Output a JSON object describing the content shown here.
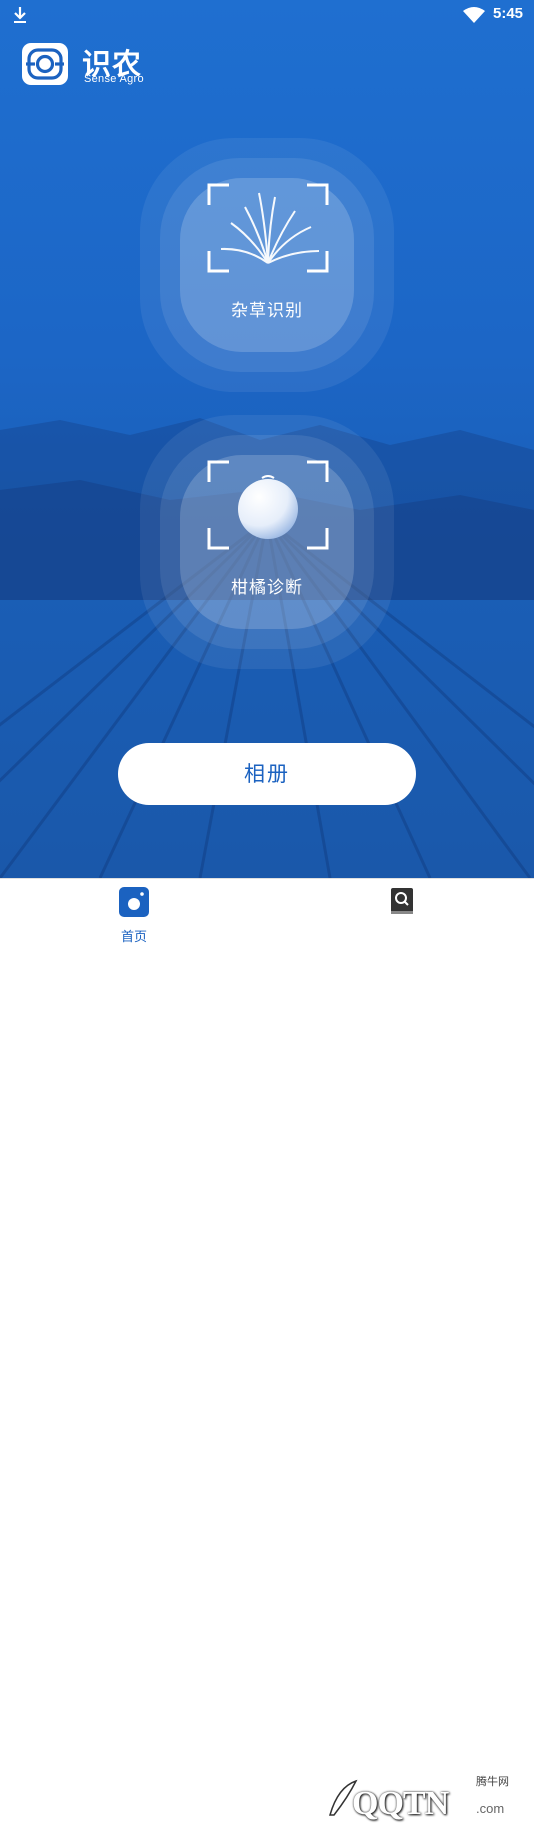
{
  "status_bar": {
    "time": "5:45",
    "icons": [
      "download-icon",
      "wifi-icon"
    ]
  },
  "header": {
    "app_name_cn": "识农",
    "app_name_en": "Sense Agro",
    "logo_icon": "camera-lens-icon"
  },
  "features": [
    {
      "label": "杂草识别",
      "icon": "weed-grass-icon"
    },
    {
      "label": "柑橘诊断",
      "icon": "citrus-fruit-icon"
    }
  ],
  "album_button": {
    "label": "相册"
  },
  "tab_bar": {
    "tabs": [
      {
        "label": "首页",
        "icon": "camera-icon",
        "active": true
      },
      {
        "label": "",
        "icon": "book-search-icon",
        "active": false
      }
    ]
  },
  "watermark": {
    "text": "QQTN",
    "cn": "腾牛网",
    "domain": ".com"
  },
  "colors": {
    "primary_blue": "#1f6fd0",
    "button_text": "#1b62c0",
    "white": "#ffffff"
  }
}
